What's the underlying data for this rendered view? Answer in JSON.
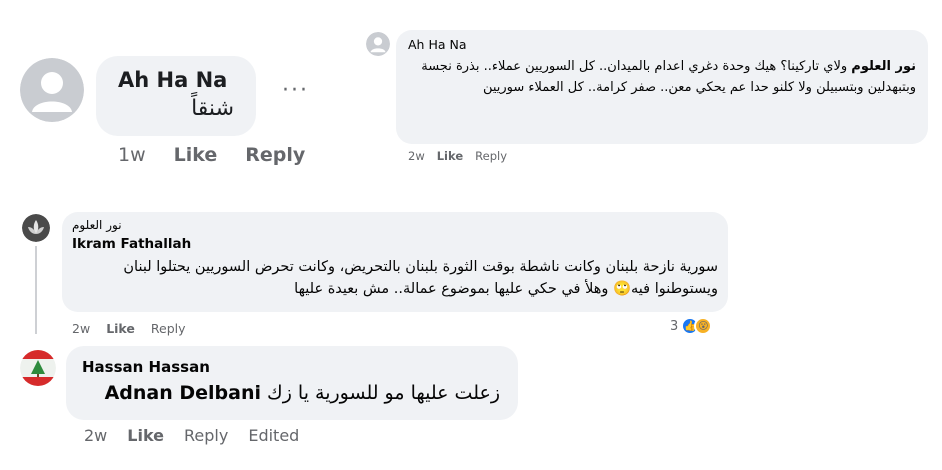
{
  "comment1": {
    "author": "Ah Ha Na",
    "text": "شنقاً",
    "more_label": "···",
    "time": "1w",
    "like_label": "Like",
    "reply_label": "Reply"
  },
  "comment2": {
    "author": "Ah Ha Na",
    "mention": "نور العلوم",
    "text": "ولاي تاركينا؟ هيك وحدة دغري اعدام بالميدان.. كل السوريين عملاء.. بذرة نجسة وبتبهدلين وبتسبيلن ولا كلنو حدا عم يحكي معن.. صفر كرامة.. كل العملاء سوريين",
    "time": "2w",
    "like_label": "Like",
    "reply_label": "Reply"
  },
  "comment3": {
    "mention": "نور العلوم",
    "author": "Ikram Fathallah",
    "text": "سورية نازحة بلبنان وكانت ناشطة بوقت الثورة بلبنان بالتحريض، وكانت تحرض السوريين يحتلوا لبنان ويستوطنوا فيه🙄 وهلأ في حكي عليها بموضوع عمالة.. مش بعيدة عليها",
    "time": "2w",
    "like_label": "Like",
    "reply_label": "Reply",
    "reaction_count": "3",
    "reactions": [
      "like-icon",
      "wow-icon"
    ]
  },
  "comment4": {
    "author": "Hassan Hassan",
    "tag": "Adnan Delbani",
    "text": "زعلت عليها مو للسورية يا زك",
    "time": "2w",
    "like_label": "Like",
    "reply_label": "Reply",
    "edited_label": "Edited"
  },
  "colors": {
    "bubble": "#f0f2f5",
    "meta_text": "#65676b",
    "like_blue": "#1877f2",
    "wow_yellow": "#f7b125"
  }
}
